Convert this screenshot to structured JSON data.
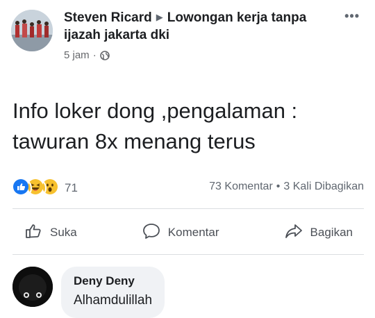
{
  "post": {
    "author": "Steven Ricard",
    "group": "Lowongan kerja tanpa ijazah jakarta dki",
    "time": "5 jam",
    "separator": "·",
    "more_label": "•••",
    "text_line1": "Info loker dong ,pengalaman :",
    "text_line2": "tawuran 8x menang terus"
  },
  "stats": {
    "reaction_count": "71",
    "comments": "73 Komentar",
    "separator": "•",
    "shares": "3 Kali Dibagikan",
    "reaction_icons": [
      "like-icon",
      "laugh-icon",
      "wow-icon"
    ]
  },
  "actions": {
    "like_label": "Suka",
    "comment_label": "Komentar",
    "share_label": "Bagikan"
  },
  "comment": {
    "author": "Deny Deny",
    "text": "Alhamdulillah"
  },
  "colors": {
    "like_blue": "#1877f2",
    "emoji_yellow": "#f7c12f",
    "text_primary": "#1c1e21",
    "text_secondary": "#65676b",
    "bubble_bg": "#f0f2f5"
  }
}
